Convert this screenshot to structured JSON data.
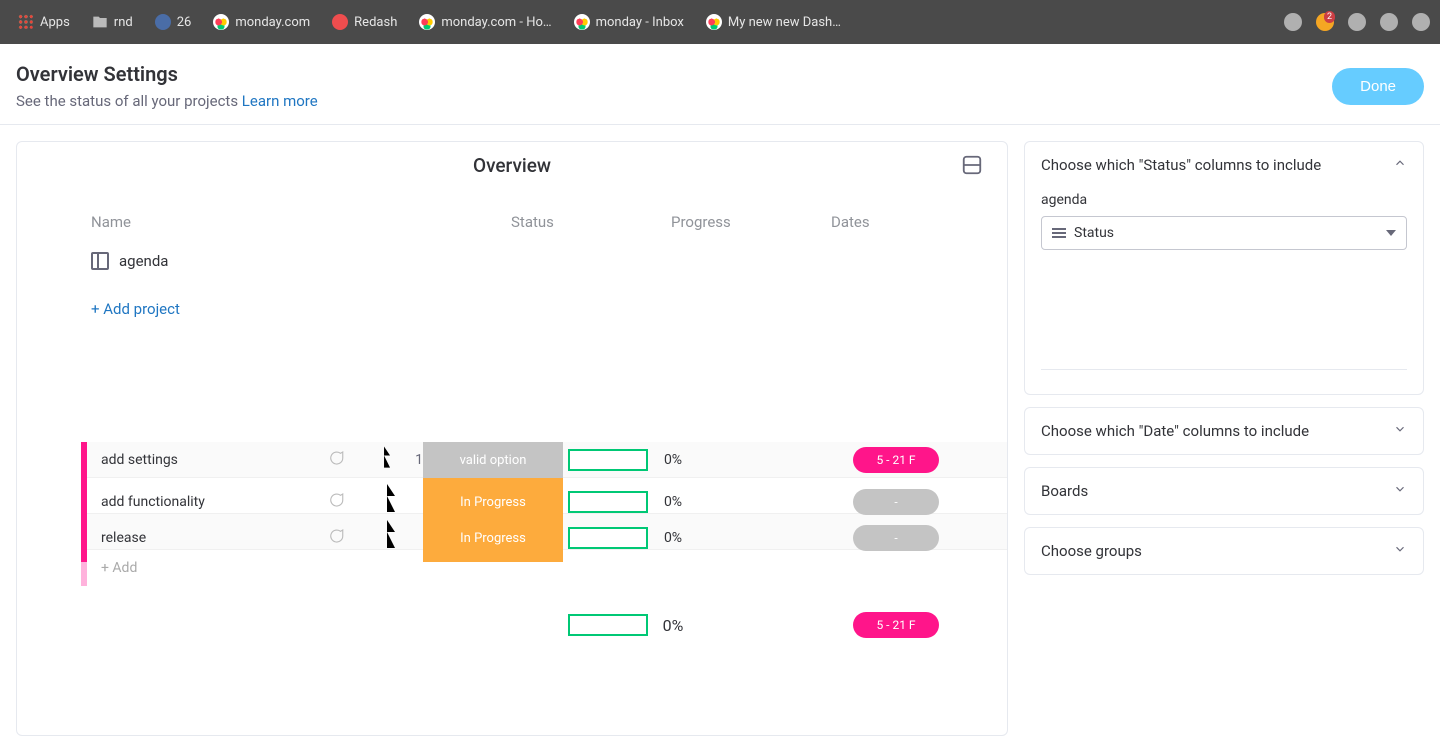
{
  "bookmarks": {
    "apps": "Apps",
    "rnd": "rnd",
    "n26": "26",
    "monday": "monday.com",
    "redash": "Redash",
    "mondayHo": "monday.com - Ho…",
    "mondayInbox": "monday - Inbox",
    "dash": "My new new Dash…",
    "badge2": "2"
  },
  "header": {
    "title": "Overview Settings",
    "subtitle_text": "See the status of all your projects ",
    "learn_more": "Learn more",
    "done": "Done"
  },
  "overview": {
    "title": "Overview",
    "columns": {
      "name": "Name",
      "status": "Status",
      "progress": "Progress",
      "dates": "Dates"
    },
    "board_name": "agenda",
    "add_project": "+ Add project"
  },
  "tasks": [
    {
      "name": "add settings",
      "subitems": "1",
      "status_label": "valid option",
      "status_class": "st-grey",
      "pct": "0%",
      "date_label": "5 - 21 F",
      "date_class": "dp-pink"
    },
    {
      "name": "add functionality",
      "subitems": "",
      "status_label": "In Progress",
      "status_class": "st-orange",
      "pct": "0%",
      "date_label": "-",
      "date_class": "dp-grey"
    },
    {
      "name": "release",
      "subitems": "",
      "status_label": "In Progress",
      "status_class": "st-orange",
      "pct": "0%",
      "date_label": "-",
      "date_class": "dp-grey"
    }
  ],
  "add_row": "+ Add",
  "summary": {
    "pct": "0%",
    "date_label": "5 - 21 F"
  },
  "sidebar": {
    "status_title": "Choose which \"Status\" columns to include",
    "status_board": "agenda",
    "status_select": "Status",
    "date_title": "Choose which \"Date\" columns to include",
    "boards_title": "Boards",
    "groups_title": "Choose groups"
  }
}
